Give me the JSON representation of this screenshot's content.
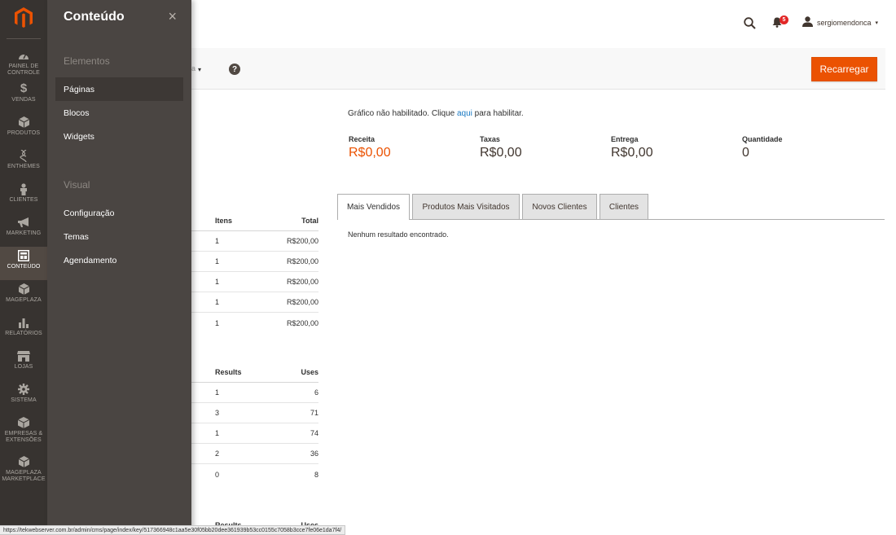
{
  "rail": {
    "items": [
      {
        "label_1": "PAINEL DE",
        "label_2": "CONTROLE",
        "icon": "dashboard-icon"
      },
      {
        "label_1": "VENDAS",
        "label_2": "",
        "icon": "dollar-icon"
      },
      {
        "label_1": "PRODUTOS",
        "label_2": "",
        "icon": "cube-icon"
      },
      {
        "label_1": "ENTHEMES",
        "label_2": "",
        "icon": "dna-icon"
      },
      {
        "label_1": "CLIENTES",
        "label_2": "",
        "icon": "person-icon"
      },
      {
        "label_1": "MARKETING",
        "label_2": "",
        "icon": "megaphone-icon"
      },
      {
        "label_1": "CONTEÚDO",
        "label_2": "",
        "icon": "layout-icon"
      },
      {
        "label_1": "MAGEPLAZA",
        "label_2": "",
        "icon": "cube-icon"
      },
      {
        "label_1": "RELATÓRIOS",
        "label_2": "",
        "icon": "bar-chart-icon"
      },
      {
        "label_1": "LOJAS",
        "label_2": "",
        "icon": "store-icon"
      },
      {
        "label_1": "SISTEMA",
        "label_2": "",
        "icon": "gear-icon"
      },
      {
        "label_1": "EMPRESAS &",
        "label_2": "EXTENSÕES",
        "icon": "cubes-icon"
      },
      {
        "label_1": "MAGEPLAZA",
        "label_2": "MARKETPLACE",
        "icon": "cube-icon"
      }
    ]
  },
  "flyout": {
    "title": "Conteúdo",
    "close_symbol": "×",
    "group_elements": "Elementos",
    "group_visual": "Visual",
    "paginas": "Páginas",
    "blocos": "Blocos",
    "widgets": "Widgets",
    "configuracao": "Configuração",
    "temas": "Temas",
    "agendamento": "Agendamento"
  },
  "header": {
    "notification_count": "5",
    "username": "sergiomendonca",
    "caret": "▾"
  },
  "toolbar": {
    "stub_text": "a",
    "caret": "▾",
    "help_symbol": "?",
    "reload_label": "Recarregar"
  },
  "chart_notice": {
    "before": "Gráfico não habilitado. Clique ",
    "link": "aqui",
    "after": " para habilitar."
  },
  "totals": [
    {
      "label": "Receita",
      "value": "R$0,00"
    },
    {
      "label": "Taxas",
      "value": "R$0,00"
    },
    {
      "label": "Entrega",
      "value": "R$0,00"
    },
    {
      "label": "Quantidade",
      "value": "0"
    }
  ],
  "orders_table": {
    "headers": [
      "Itens",
      "Total"
    ],
    "rows": [
      [
        "1",
        "R$200,00"
      ],
      [
        "1",
        "R$200,00"
      ],
      [
        "1",
        "R$200,00"
      ],
      [
        "1",
        "R$200,00"
      ],
      [
        "1",
        "R$200,00"
      ]
    ]
  },
  "search_table": {
    "headers": [
      "Results",
      "Uses"
    ],
    "rows": [
      [
        "1",
        "6"
      ],
      [
        "3",
        "71"
      ],
      [
        "1",
        "74"
      ],
      [
        "2",
        "36"
      ],
      [
        "0",
        "8"
      ]
    ]
  },
  "search_table_2": {
    "headers": [
      "Results",
      "Uses"
    ]
  },
  "tabs": {
    "items": [
      "Mais Vendidos",
      "Produtos Mais Visitados",
      "Novos Clientes",
      "Clientes"
    ],
    "empty_message": "Nenhum resultado encontrado."
  },
  "status_bar": {
    "url": "https://tekwebserver.com.br/admin/cms/page/index/key/517366948c1aa5e30f05bb20dee361939b53cc0155c7058b3cce7fe06e1da7f4/"
  },
  "colors": {
    "accent": "#eb5202",
    "rail_bg": "#373330",
    "flyout_bg": "#4a4542",
    "link": "#1979c3"
  }
}
